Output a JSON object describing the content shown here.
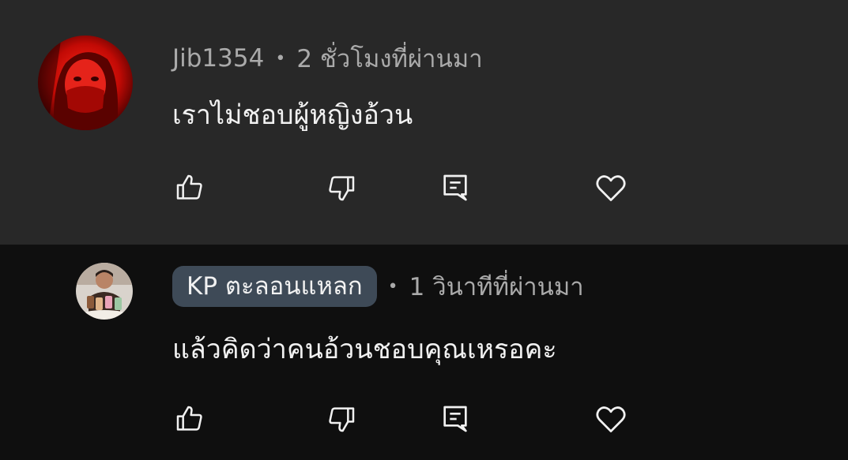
{
  "comments": [
    {
      "author": "Jib1354",
      "separator": "•",
      "time": "2 ชั่วโมงที่ผ่านมา",
      "text": "เราไม่ชอบผู้หญิงอ้วน",
      "author_highlighted": false,
      "icons": [
        "thumb-up-icon",
        "thumb-down-icon",
        "reply-icon",
        "heart-icon"
      ]
    },
    {
      "author": "KP ตะลอนแหลก",
      "separator": "•",
      "time": "1 วินาทีที่ผ่านมา",
      "text": "แล้วคิดว่าคนอ้วนชอบคุณเหรอคะ",
      "author_highlighted": true,
      "icons": [
        "thumb-up-icon",
        "thumb-down-icon",
        "reply-icon",
        "heart-icon"
      ]
    }
  ],
  "colors": {
    "highlight_bg": "#282828",
    "page_bg": "#0f0f0f",
    "author_chip_bg": "#3e4a57",
    "meta_text": "#aaaaaa",
    "body_text": "#f1f1f1"
  }
}
